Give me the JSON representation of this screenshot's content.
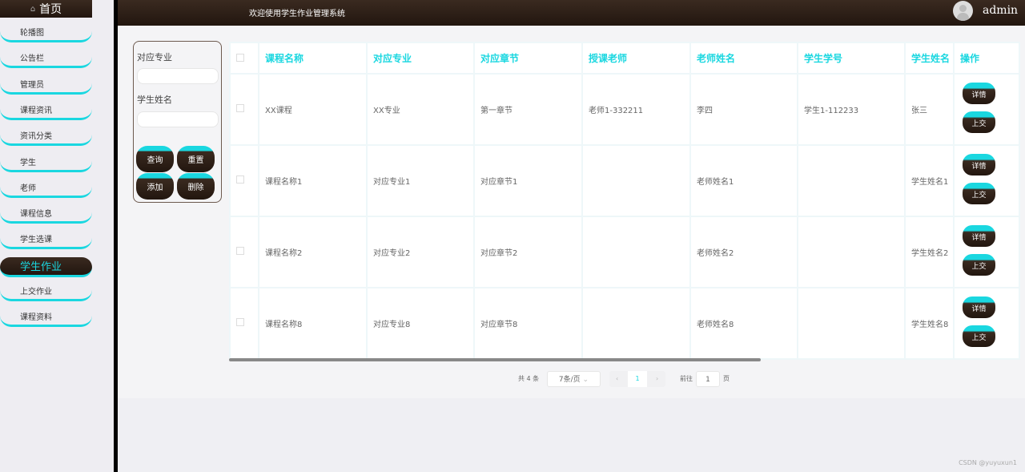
{
  "sidebar": {
    "home": "首页",
    "items": [
      "轮播图",
      "公告栏",
      "管理员",
      "课程资讯",
      "资讯分类",
      "学生",
      "老师",
      "课程信息",
      "学生选课",
      "学生作业",
      "上交作业",
      "课程资料"
    ],
    "active": 9
  },
  "header": {
    "title": "欢迎使用学生作业管理系统",
    "user": "admin"
  },
  "search": {
    "label1": "对应专业",
    "label2": "学生姓名",
    "query": "查询",
    "reset": "重置",
    "add": "添加",
    "delete": "删除"
  },
  "table": {
    "headers": [
      "课程名称",
      "对应专业",
      "对应章节",
      "授课老师",
      "老师姓名",
      "学生学号",
      "学生姓名",
      "操作"
    ],
    "rows": [
      [
        "XX课程",
        "XX专业",
        "第一章节",
        "老师1-332211",
        "李四",
        "学生1-112233",
        "张三"
      ],
      [
        "课程名称1",
        "对应专业1",
        "对应章节1",
        "",
        "老师姓名1",
        "",
        "学生姓名1"
      ],
      [
        "课程名称2",
        "对应专业2",
        "对应章节2",
        "",
        "老师姓名2",
        "",
        "学生姓名2"
      ],
      [
        "课程名称8",
        "对应专业8",
        "对应章节8",
        "",
        "老师姓名8",
        "",
        "学生姓名8"
      ]
    ],
    "detail": "详情",
    "submit": "上交"
  },
  "pagination": {
    "total": "共 4 条",
    "page_size": "7条/页",
    "current": "1",
    "goto": "前往",
    "goto_value": "1",
    "page_unit": "页"
  },
  "watermark": "CSDN @yuyuxun1"
}
